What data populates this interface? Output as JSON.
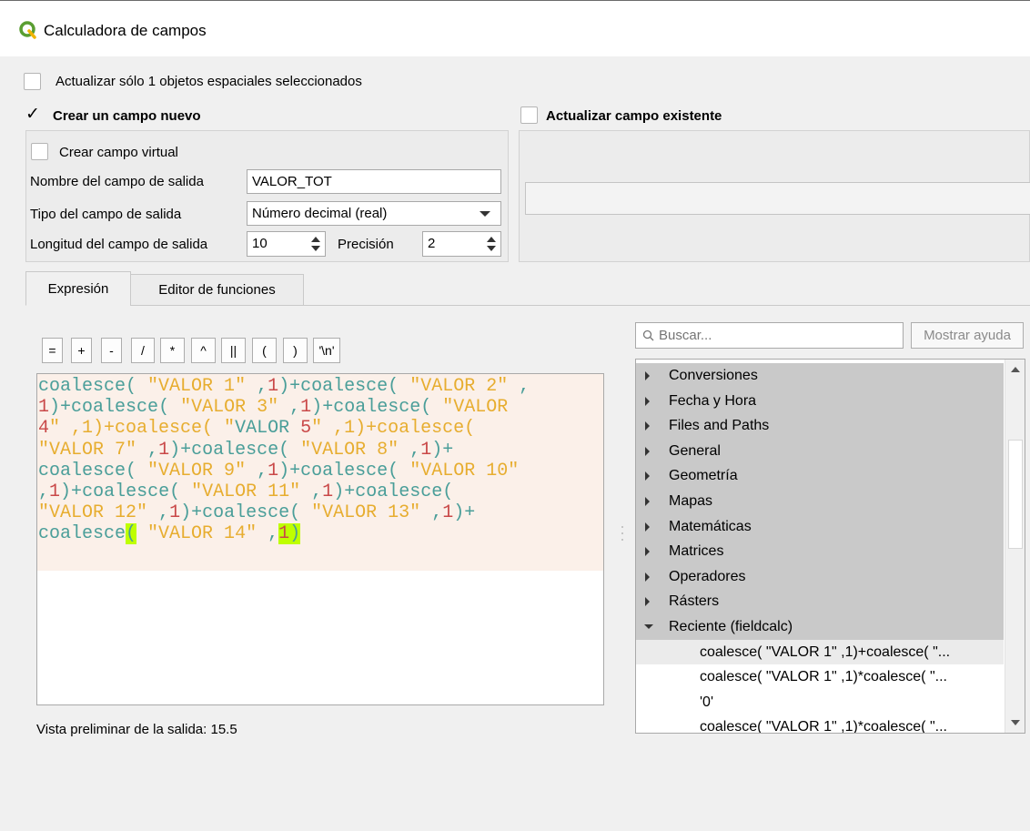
{
  "window": {
    "title": "Calculadora de campos",
    "icon": "qgis-logo-icon"
  },
  "options": {
    "update_selected_label": "Actualizar sólo 1 objetos espaciales seleccionados",
    "update_selected_checked": false,
    "create_new_label": "Crear un campo nuevo",
    "create_new_checked": true,
    "update_existing_label": "Actualizar campo existente",
    "update_existing_checked": false
  },
  "new_field": {
    "virtual_label": "Crear campo virtual",
    "virtual_checked": false,
    "name_label": "Nombre del campo de salida",
    "name_value": "VALOR_TOT",
    "type_label": "Tipo del campo de salida",
    "type_value": "Número decimal (real)",
    "length_label": "Longitud del campo de salida",
    "length_value": "10",
    "precision_label": "Precisión",
    "precision_value": "2"
  },
  "tabs": [
    {
      "label": "Expresión",
      "active": true
    },
    {
      "label": "Editor de funciones",
      "active": false
    }
  ],
  "operators": [
    "=",
    "+",
    "-",
    "/",
    "*",
    "^",
    "||",
    "(",
    ")",
    "'\\n'"
  ],
  "expression": {
    "lines": [
      "coalesce( \"VALOR 1\" ,1)+coalesce( \"VALOR 2\" ,",
      "1)+coalesce( \"VALOR 3\" ,1)+coalesce( \"VALOR",
      "4\" ,1)+coalesce( \"VALOR 5\" ,1)+coalesce(",
      "\"VALOR 7\" ,1)+coalesce( \"VALOR 8\" ,1)+",
      "coalesce( \"VALOR 9\" ,1)+coalesce( \"VALOR 10\"",
      ",1)+coalesce( \"VALOR 11\" ,1)+coalesce(",
      "\"VALOR 12\" ,1)+coalesce( \"VALOR 13\" ,1)+",
      "coalesce( \"VALOR 14\" ,1)"
    ],
    "colors": {
      "function": "#4a9e99",
      "string": "#e7ad2f",
      "number": "#c94848",
      "bracket_highlight": "#bfff00"
    }
  },
  "preview": {
    "label": "Vista preliminar de la salida:",
    "value": "15.5"
  },
  "search": {
    "placeholder": "Buscar...",
    "help_label": "Mostrar ayuda"
  },
  "function_tree": {
    "groups": [
      "Conversiones",
      "Fecha y Hora",
      "Files and Paths",
      "General",
      "Geometría",
      "Mapas",
      "Matemáticas",
      "Matrices",
      "Operadores",
      "Rásters"
    ],
    "expanded_group": "Reciente (fieldcalc)",
    "recent_items": [
      "coalesce( \"VALOR 1\" ,1)+coalesce( \"...",
      "coalesce( \"VALOR 1\" ,1)*coalesce( \"...",
      "'0'",
      "coalesce( \"VALOR 1\" ,1)*coalesce( \"..."
    ]
  }
}
